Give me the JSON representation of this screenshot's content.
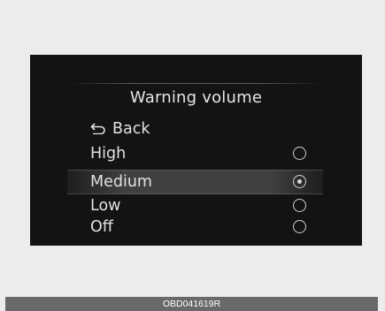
{
  "screen": {
    "title": "Warning volume",
    "back": {
      "label": "Back",
      "icon": "back-arrow-icon"
    },
    "options": [
      {
        "label": "High",
        "selected": false
      },
      {
        "label": "Medium",
        "selected": true
      },
      {
        "label": "Low",
        "selected": false
      },
      {
        "label": "Off",
        "selected": false
      }
    ]
  },
  "footer": {
    "code": "OBD041619R"
  },
  "colors": {
    "screen_bg": "#131313",
    "text": "#e2e2e2",
    "page_bg": "#ececec",
    "footer_bg": "#696969"
  }
}
